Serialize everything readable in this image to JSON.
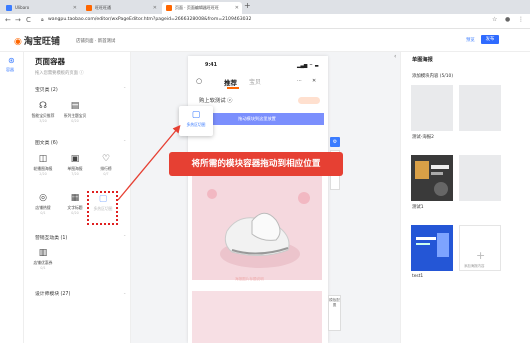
{
  "browser": {
    "tabs": [
      {
        "label": "Ulibaro",
        "favicon_color": "#3b7cff"
      },
      {
        "label": "旺旺旺通",
        "favicon_color": "#f60"
      },
      {
        "label": "页面 · 页面编辑器旺旺旺",
        "favicon_color": "#f60"
      }
    ],
    "new_tab": "+",
    "url": "wangpu.taobao.com/editor/wxPageEditor.htm?pageid=2666328008&from=2109463032",
    "back": "←",
    "forward": "→",
    "reload": "C"
  },
  "header": {
    "logo": "淘宝旺铺",
    "subnav": "店铺页面 · 新首测试",
    "preview": "预览",
    "publish": "发布"
  },
  "rail": {
    "label": "容器"
  },
  "left_panel": {
    "title": "页面容器",
    "subtitle": "拖入您需要模板的页面 ⓘ",
    "categories": [
      {
        "label": "宝贝类 (2)"
      },
      {
        "label": "图文类 (6)"
      },
      {
        "label": "营销互动类 (1)"
      },
      {
        "label": "设计师模块 (27)"
      }
    ],
    "items_goods": [
      {
        "name": "智能宝贝推荐",
        "count": "3/20"
      },
      {
        "name": "系列主题宝贝",
        "count": "0/20"
      }
    ],
    "items_pic": [
      {
        "name": "轮播图海报",
        "count": "2/20"
      },
      {
        "name": "单图海报",
        "count": "7/20"
      },
      {
        "name": "排行榜",
        "count": "0/7"
      },
      {
        "name": "店铺热搜",
        "count": "0/1"
      },
      {
        "name": "文字标题",
        "count": "0/20"
      },
      {
        "name": "多热区切图",
        "count": ""
      }
    ],
    "items_mkt": [
      {
        "name": "店铺优惠券",
        "count": "0/1"
      }
    ]
  },
  "phone": {
    "time": "9:41",
    "status": "▂▄▆ ⌔ ▬",
    "tab_active": "推荐",
    "tab_other": "宝贝",
    "more": "···",
    "close": "✕",
    "section_title": "购上软测试 ⓥ",
    "drop_hint": "拖动模块到这里放置",
    "drag_label": "多热区切图",
    "hero_caption": "海报图片标题说明",
    "side_tools": "模板配置"
  },
  "callout": "将所需的模块容器拖动到相应位置",
  "right_panel": {
    "title": "单图海报",
    "subtitle": "添加模块内容 (5/10)",
    "slots": [
      {
        "label": "",
        "kind": "empty"
      },
      {
        "label": "",
        "kind": "empty"
      },
      {
        "label": "测试-海报2",
        "kind": "empty"
      },
      {
        "label": "",
        "kind": "empty"
      },
      {
        "label": "测试1",
        "kind": "image-dark"
      },
      {
        "label": "",
        "kind": "empty"
      },
      {
        "label": "test1",
        "kind": "image-blue"
      }
    ],
    "add_label": "添加海报内容"
  },
  "colors": {
    "accent": "#3b7cff",
    "brand": "#ff6600",
    "callout": "#e64033",
    "drop": "#7b8ffd"
  }
}
